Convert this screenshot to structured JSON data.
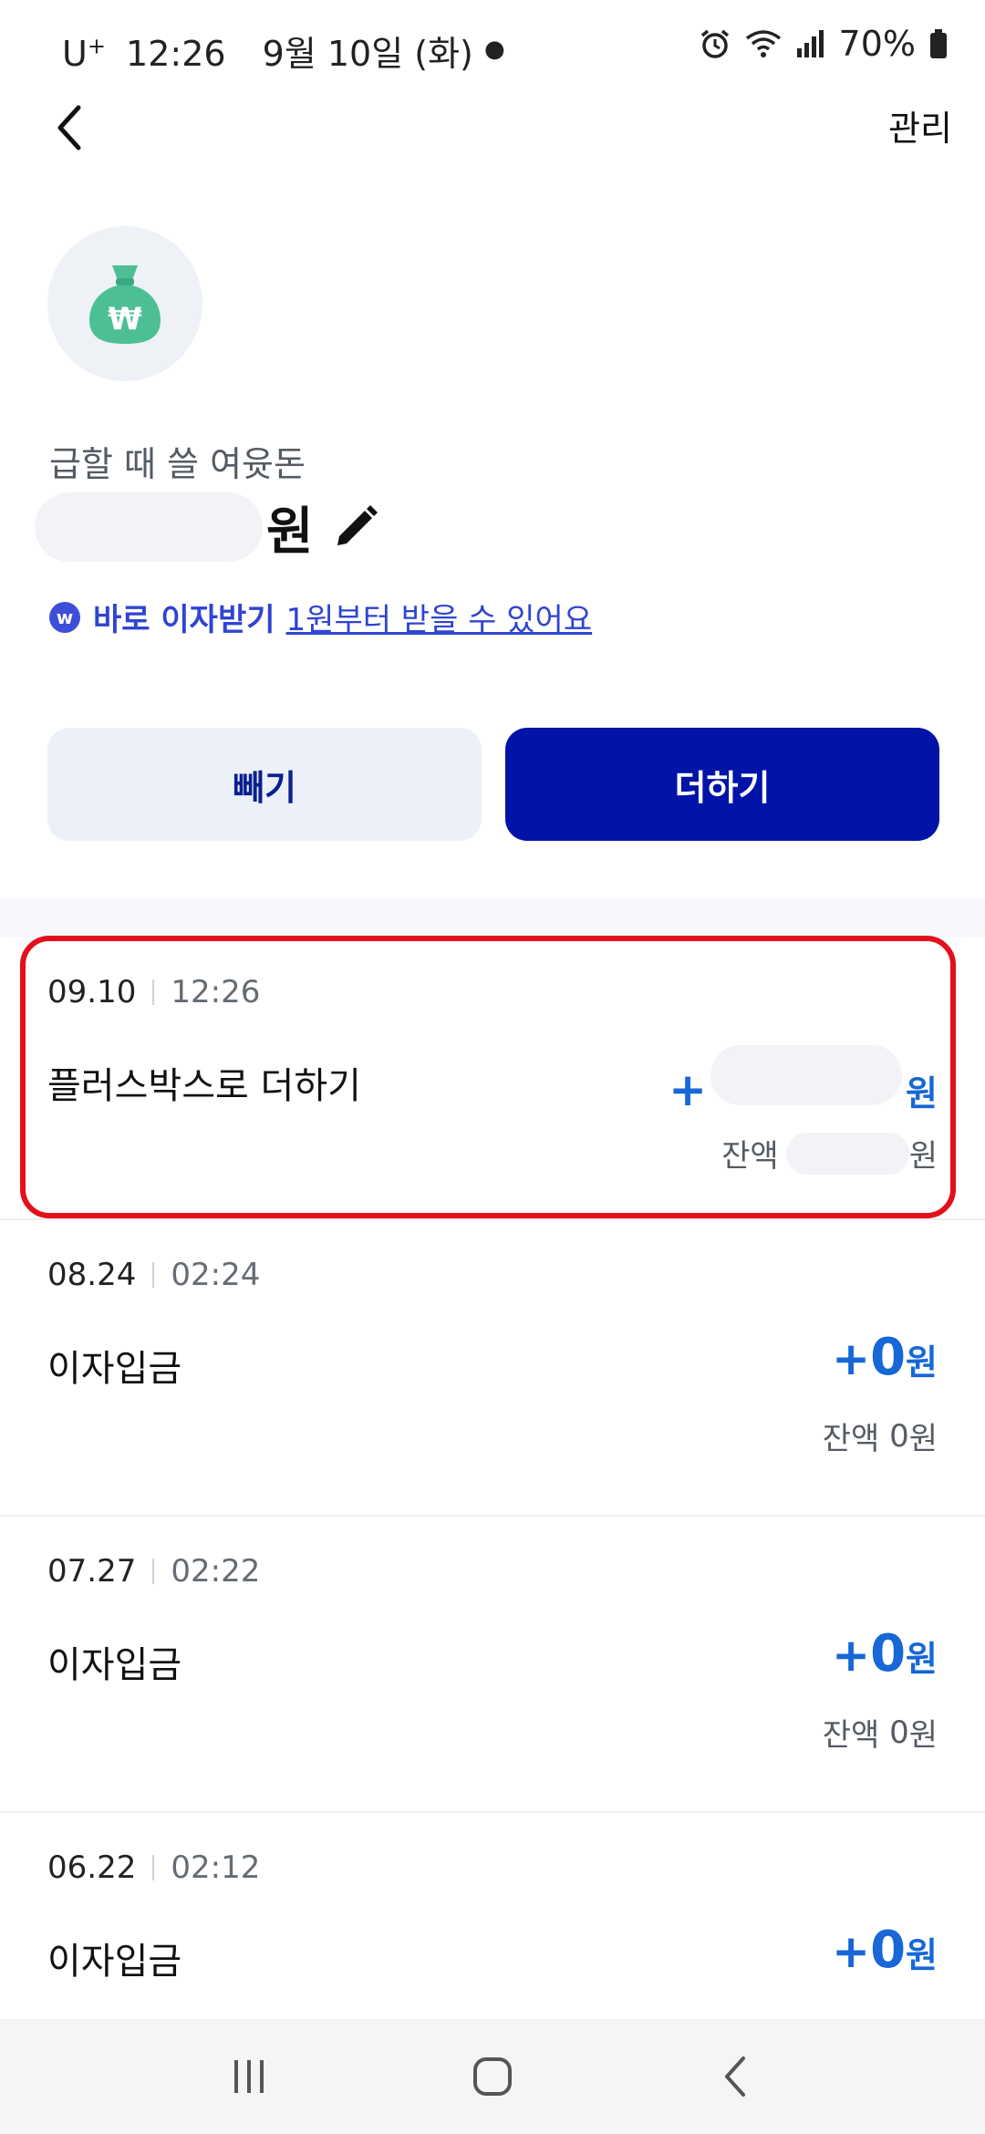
{
  "status_bar": {
    "carrier": "U",
    "carrier_sup": "+",
    "time": "12:26",
    "date": "9월 10일 (화)",
    "battery": "70%"
  },
  "header": {
    "back_icon": "chevron-left-icon",
    "manage_label": "관리"
  },
  "account": {
    "icon": "money-bag-won-icon",
    "name": "급할 때 쓸 여윳돈",
    "balance_unit": "원",
    "edit_icon": "pencil-icon"
  },
  "interest": {
    "badge": "w",
    "title": "바로 이자받기",
    "link_text": "1원부터 받을 수 있어요"
  },
  "actions": {
    "withdraw_label": "빼기",
    "add_label": "더하기"
  },
  "transactions": [
    {
      "date": "09.10",
      "time": "12:26",
      "title": "플러스박스로 더하기",
      "sign": "+",
      "amount": "",
      "unit": "원",
      "balance_label": "잔액",
      "balance_value": "",
      "balance_unit": "원"
    },
    {
      "date": "08.24",
      "time": "02:24",
      "title": "이자입금",
      "sign": "+",
      "amount": "0",
      "unit": "원",
      "balance_label": "잔액",
      "balance_value": "0",
      "balance_unit": "원"
    },
    {
      "date": "07.27",
      "time": "02:22",
      "title": "이자입금",
      "sign": "+",
      "amount": "0",
      "unit": "원",
      "balance_label": "잔액",
      "balance_value": "0",
      "balance_unit": "원"
    },
    {
      "date": "06.22",
      "time": "02:12",
      "title": "이자입금",
      "sign": "+",
      "amount": "0",
      "unit": "원",
      "balance_label": "",
      "balance_value": "",
      "balance_unit": ""
    }
  ],
  "colors": {
    "accent_blue": "#0213a8",
    "amount_blue": "#1767d6",
    "link_blue": "#2f44d1",
    "highlight_red": "#e3101c",
    "icon_green": "#4cbf95"
  },
  "nav": {
    "recents_icon": "recents-icon",
    "home_icon": "home-icon",
    "back_icon": "back-icon"
  }
}
